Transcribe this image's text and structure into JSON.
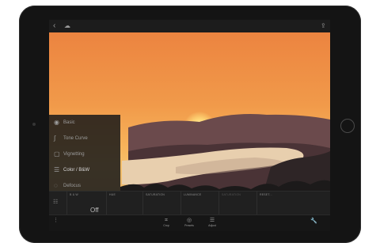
{
  "device": {
    "type": "tablet"
  },
  "topbar": {
    "back_icon": "back-chevron-icon",
    "cloud_icon": "cloud-icon",
    "share_icon": "share-icon"
  },
  "photo": {
    "subject": "sunset over hills and bay"
  },
  "panel": {
    "items": [
      {
        "label": "Basic",
        "icon": "basic-aperture-icon"
      },
      {
        "label": "Tone Curve",
        "icon": "tone-curve-icon"
      },
      {
        "label": "Vignetting",
        "icon": "vignetting-icon"
      },
      {
        "label": "Color / B&W",
        "icon": "color-bw-icon"
      },
      {
        "label": "Defocus",
        "icon": "defocus-icon"
      }
    ],
    "active_index": 3
  },
  "color_panel": {
    "columns": [
      {
        "label": "B & W"
      },
      {
        "label": "HUE"
      },
      {
        "label": "SATURATION"
      },
      {
        "label": "LUMINANCE"
      },
      {
        "label": "SATURATION"
      },
      {
        "label": "RESET..."
      }
    ],
    "bw_state": "Off"
  },
  "bottombar": {
    "crop": "Crop",
    "presets": "Presets",
    "adjust": "Adjust"
  }
}
